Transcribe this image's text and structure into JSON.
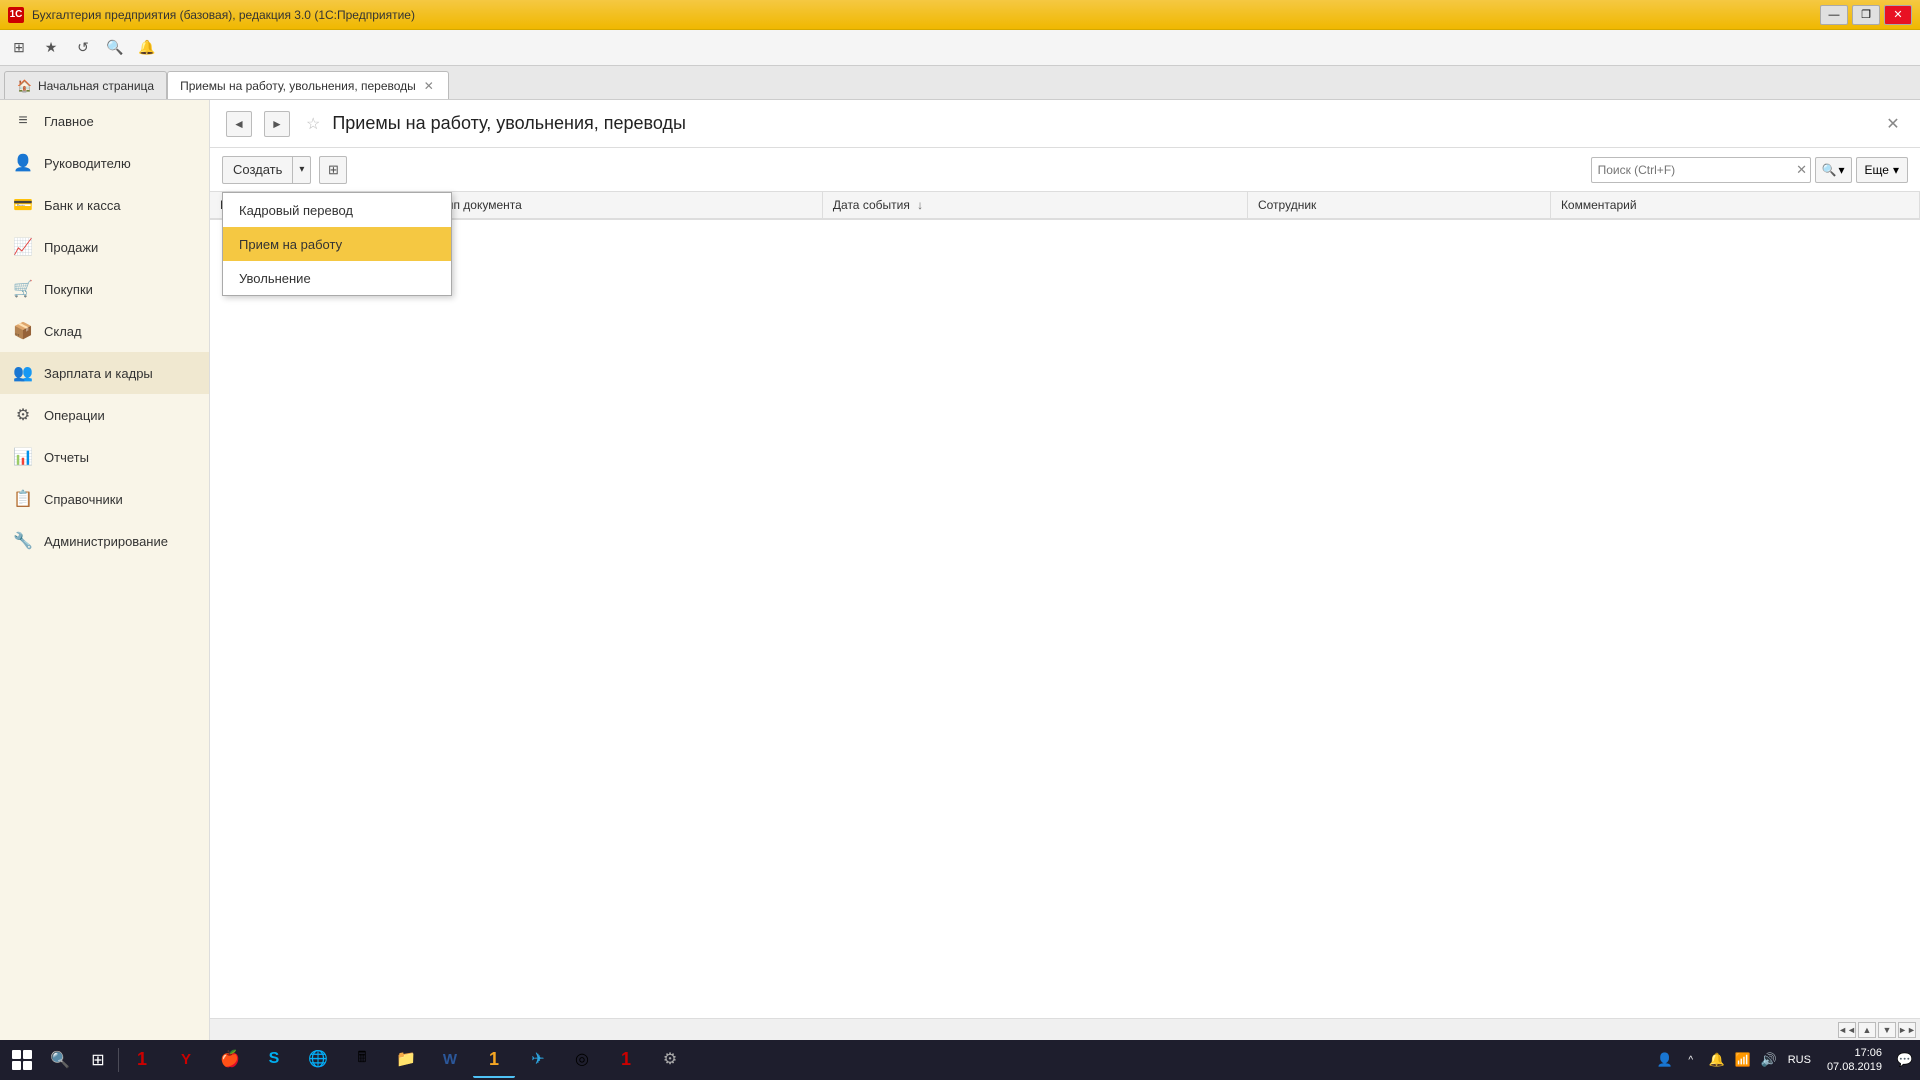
{
  "titlebar": {
    "icon_label": "1C",
    "title": "Бухгалтерия предприятия (базовая), редакция 3.0 (1С:Предприятие)",
    "controls": {
      "minimize": "—",
      "maximize": "□",
      "restore": "❐",
      "close": "✕"
    }
  },
  "toolbar": {
    "buttons": [
      "←",
      "→",
      "⊞",
      "🔍",
      "★",
      "📋",
      "🔔"
    ]
  },
  "tabs": [
    {
      "id": "home",
      "label": "Начальная страница",
      "closable": false
    },
    {
      "id": "docs",
      "label": "Приемы на работу, увольнения, переводы",
      "closable": true,
      "active": true
    }
  ],
  "sidebar": {
    "items": [
      {
        "id": "glavnoe",
        "label": "Главное",
        "icon": "≡"
      },
      {
        "id": "rukovoditelyu",
        "label": "Руководителю",
        "icon": "👤"
      },
      {
        "id": "bank",
        "label": "Банк и касса",
        "icon": "💳"
      },
      {
        "id": "prodazhi",
        "label": "Продажи",
        "icon": "📈"
      },
      {
        "id": "pokupki",
        "label": "Покупки",
        "icon": "🛒"
      },
      {
        "id": "sklad",
        "label": "Склад",
        "icon": "📦"
      },
      {
        "id": "zarplata",
        "label": "Зарплата и кадры",
        "icon": "👥"
      },
      {
        "id": "operacii",
        "label": "Операции",
        "icon": "⚙"
      },
      {
        "id": "otchety",
        "label": "Отчеты",
        "icon": "📊"
      },
      {
        "id": "spravochniki",
        "label": "Справочники",
        "icon": "📋"
      },
      {
        "id": "administrirovanie",
        "label": "Администрирование",
        "icon": "🔧"
      }
    ]
  },
  "page": {
    "title": "Приемы на работу, увольнения, переводы",
    "close_label": "✕",
    "star_icon": "☆"
  },
  "action_toolbar": {
    "create_label": "Создать",
    "create_arrow": "▾",
    "copy_icon": "⊞",
    "search_placeholder": "Поиск (Ctrl+F)",
    "search_clear": "✕",
    "search_icon": "🔍",
    "search_arrow": "▾",
    "more_label": "Еще",
    "more_arrow": "▾"
  },
  "table": {
    "columns": [
      {
        "id": "number",
        "label": "Номер"
      },
      {
        "id": "tip_doc",
        "label": "Тип документа"
      },
      {
        "id": "data_sobytia",
        "label": "Дата события",
        "sortable": true
      },
      {
        "id": "sotrudnik",
        "label": "Сотрудник"
      },
      {
        "id": "kommentariy",
        "label": "Комментарий"
      }
    ],
    "rows": []
  },
  "dropdown": {
    "items": [
      {
        "id": "kadroviy_perevod",
        "label": "Кадровый перевод",
        "highlighted": false
      },
      {
        "id": "priem_na_rabotu",
        "label": "Прием на работу",
        "highlighted": true
      },
      {
        "id": "uvolnenie",
        "label": "Увольнение",
        "highlighted": false
      }
    ]
  },
  "scroll": {
    "buttons": [
      "◄",
      "◄◄",
      "▼",
      "►"
    ]
  },
  "taskbar": {
    "apps": [
      {
        "id": "explorer",
        "icon": "🗂",
        "active": false
      },
      {
        "id": "search",
        "icon": "🔍",
        "active": false
      },
      {
        "id": "taskview",
        "icon": "⊞",
        "active": false
      },
      {
        "id": "1c_red",
        "icon": "①",
        "active": false,
        "color": "#cc0000"
      },
      {
        "id": "yandex",
        "icon": "Y",
        "active": false
      },
      {
        "id": "apple",
        "icon": "🍎",
        "active": false
      },
      {
        "id": "skype",
        "icon": "S",
        "active": false
      },
      {
        "id": "browser",
        "icon": "🌐",
        "active": false
      },
      {
        "id": "calc",
        "icon": "🖩",
        "active": false
      },
      {
        "id": "files",
        "icon": "📁",
        "active": false
      },
      {
        "id": "word",
        "icon": "W",
        "active": false
      },
      {
        "id": "1c_orange",
        "icon": "①",
        "active": true
      },
      {
        "id": "telegram",
        "icon": "✈",
        "active": false
      },
      {
        "id": "chrome_like",
        "icon": "◎",
        "active": false
      },
      {
        "id": "1c_alt",
        "icon": "①",
        "active": false
      },
      {
        "id": "settings",
        "icon": "⚙",
        "active": false
      }
    ],
    "tray": {
      "icons": [
        "👤",
        "^",
        "🔔",
        "📶",
        "🔊"
      ],
      "lang": "RUS",
      "time": "17:06",
      "date": "07.08.2019",
      "notification": "💬"
    }
  }
}
